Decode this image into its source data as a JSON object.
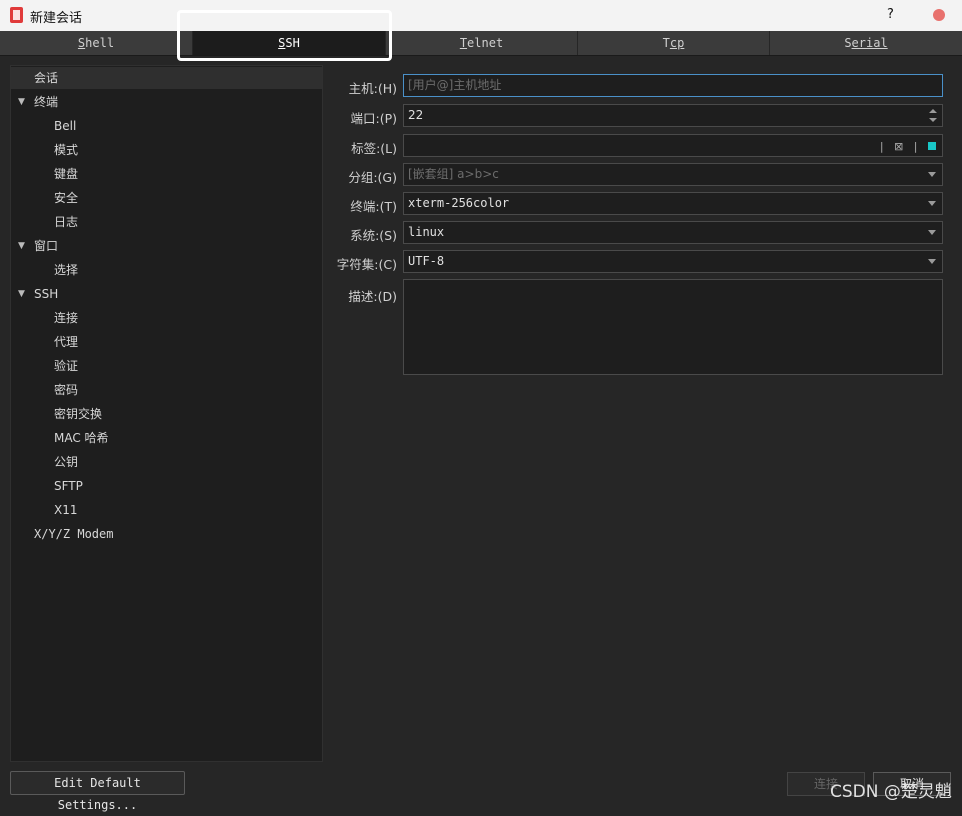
{
  "window": {
    "title": "新建会话",
    "help": "?"
  },
  "tabs": [
    {
      "label": "Shell",
      "u": "S",
      "rest": "hell"
    },
    {
      "label": "SSH",
      "u": "S",
      "rest": "SH"
    },
    {
      "label": "Telnet",
      "u": "T",
      "rest": "elnet"
    },
    {
      "label": "Tcp",
      "u": "T",
      "rest": "cp"
    },
    {
      "label": "Serial",
      "u": "S",
      "rest": "erial"
    }
  ],
  "tree": {
    "session": "会话",
    "terminal": "终端",
    "bell": "Bell",
    "mode": "模式",
    "keyboard": "键盘",
    "security": "安全",
    "log": "日志",
    "window": "窗口",
    "select": "选择",
    "ssh": "SSH",
    "connection": "连接",
    "proxy": "代理",
    "auth": "验证",
    "password": "密码",
    "kex": "密钥交换",
    "mac": "MAC 哈希",
    "pubkey": "公钥",
    "sftp": "SFTP",
    "x11": "X11",
    "modem": "X/Y/Z Modem"
  },
  "form": {
    "host_label": "主机:(H)",
    "host_placeholder": "[用户@]主机地址",
    "port_label": "端口:(P)",
    "port_value": "22",
    "tag_label": "标签:(L)",
    "tag_sep": "|",
    "tag_clear": "⊠",
    "group_label": "分组:(G)",
    "group_placeholder": "[嵌套组] a>b>c",
    "terminal_label": "终端:(T)",
    "terminal_value": "xterm-256color",
    "system_label": "系统:(S)",
    "system_value": "linux",
    "charset_label": "字符集:(C)",
    "charset_value": "UTF-8",
    "desc_label": "描述:(D)"
  },
  "buttons": {
    "edit_default": "Edit Default Settings...",
    "connect": "连接",
    "cancel": "取消"
  },
  "watermark": "CSDN @楚灵魈",
  "colors": {
    "tag_color": "#19c7c7",
    "close": "#e8716d",
    "app_icon": "#e03a3a"
  }
}
